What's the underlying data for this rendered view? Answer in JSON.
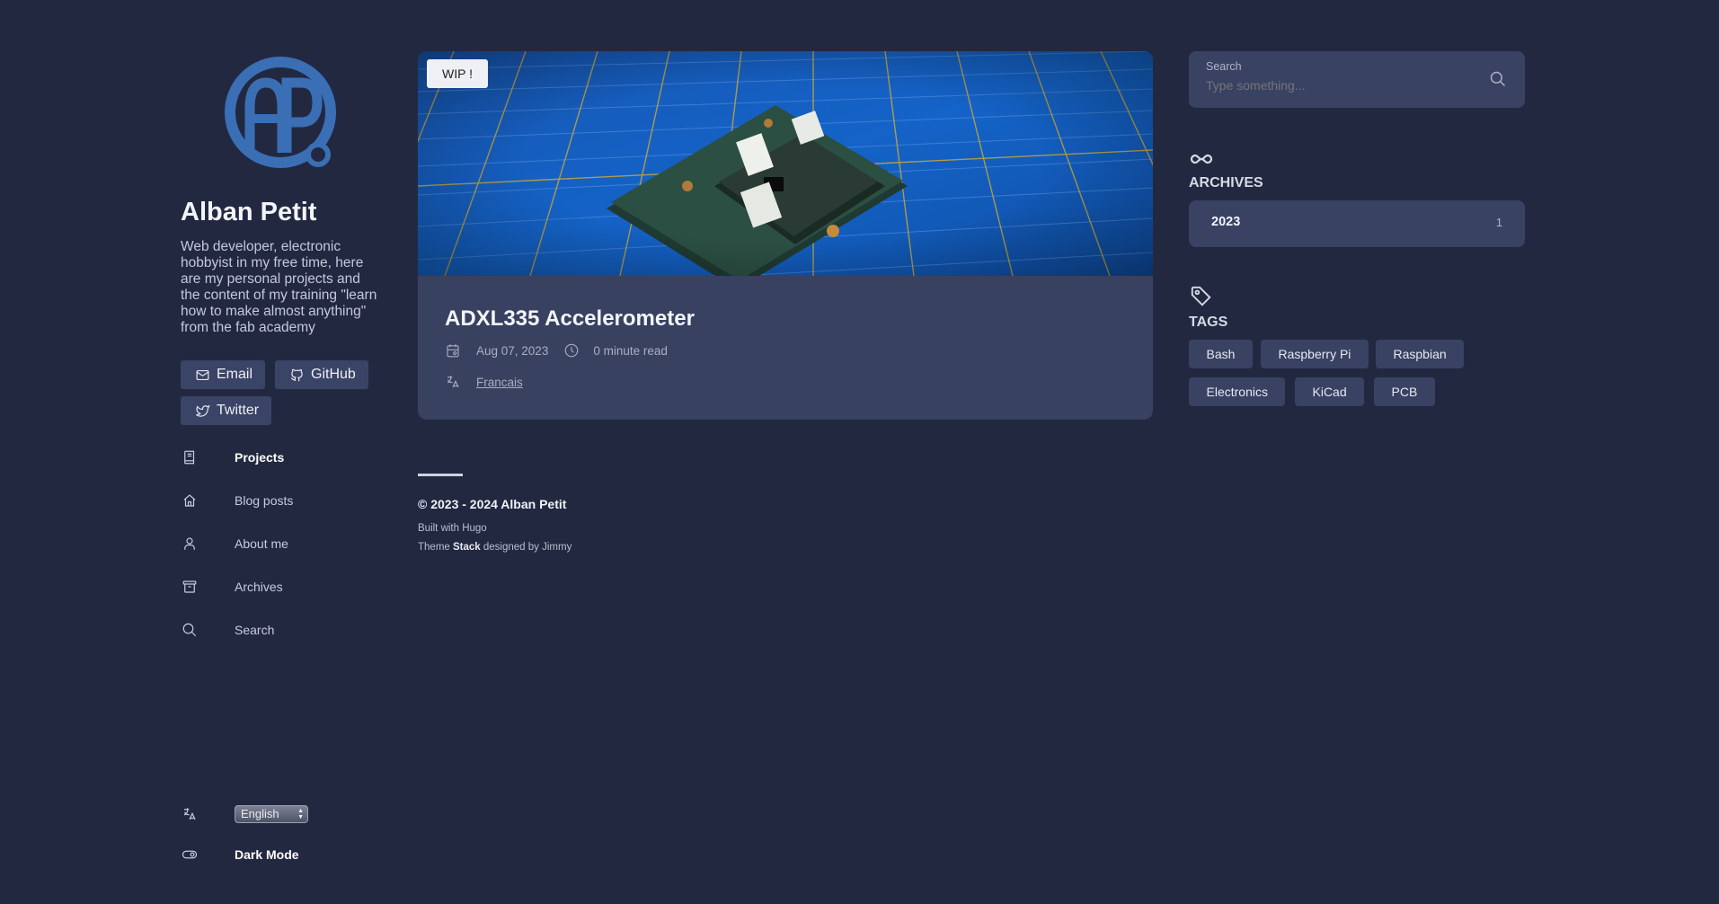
{
  "sidebar": {
    "author_name": "Alban Petit",
    "description": "Web developer, electronic hobbyist in my free time, here are my personal projects and the content of my training \"learn how to make almost anything\" from the fab academy",
    "social": [
      {
        "label": "Email",
        "icon": "email-icon"
      },
      {
        "label": "GitHub",
        "icon": "github-icon"
      },
      {
        "label": "Twitter",
        "icon": "twitter-icon"
      }
    ],
    "menu": [
      {
        "label": "Projects",
        "icon": "book-icon",
        "active": true
      },
      {
        "label": "Blog posts",
        "icon": "home-icon",
        "active": false
      },
      {
        "label": "About me",
        "icon": "user-icon",
        "active": false
      },
      {
        "label": "Archives",
        "icon": "archive-icon",
        "active": false
      },
      {
        "label": "Search",
        "icon": "search-icon",
        "active": false
      }
    ],
    "language": {
      "selected": "English",
      "icon": "language-icon"
    },
    "dark_mode": {
      "label": "Dark Mode",
      "icon": "toggle-icon"
    }
  },
  "article": {
    "badge": "WIP !",
    "title": "ADXL335 Accelerometer",
    "date": "Aug 07, 2023",
    "read_time": "0 minute read",
    "translation": "Francais"
  },
  "footer": {
    "copyright": "© 2023 - 2024 Alban Petit",
    "built_with": "Built with Hugo",
    "theme_prefix": "Theme",
    "theme_name": "Stack",
    "theme_suffix": "designed by Jimmy"
  },
  "search": {
    "label": "Search",
    "placeholder": "Type something..."
  },
  "archives": {
    "title": "ARCHIVES",
    "items": [
      {
        "year": "2023",
        "count": "1"
      }
    ]
  },
  "tags": {
    "title": "TAGS",
    "items": [
      "Bash",
      "Raspberry Pi",
      "Raspbian",
      "Electronics",
      "KiCad",
      "PCB"
    ]
  },
  "colors": {
    "background": "#232841",
    "card": "#384160",
    "widget": "#394263",
    "accent_logo": "#3a6fb5"
  }
}
